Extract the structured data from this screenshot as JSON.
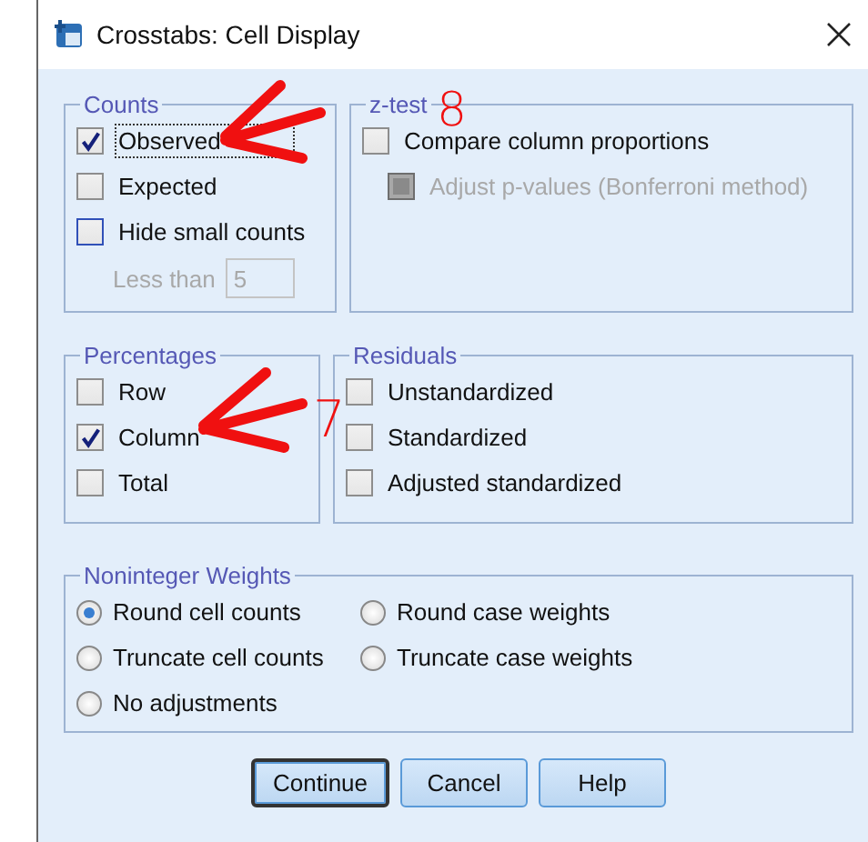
{
  "window": {
    "title": "Crosstabs: Cell Display"
  },
  "counts": {
    "title": "Counts",
    "options": [
      {
        "label": "Observed",
        "checked": true,
        "focused": true
      },
      {
        "label": "Expected",
        "checked": false,
        "focused": false
      },
      {
        "label": "Hide small counts",
        "checked": false,
        "focused": false
      }
    ],
    "less_than": {
      "label": "Less than",
      "value": "5",
      "disabled": true
    }
  },
  "z_test": {
    "title": "z-test",
    "options": [
      {
        "label": "Compare column proportions",
        "checked": false,
        "disabled": false,
        "children": [
          {
            "label": "Adjust p-values (Bonferroni method)",
            "checked": false,
            "disabled": true
          }
        ]
      }
    ]
  },
  "percentages": {
    "title": "Percentages",
    "options": [
      {
        "label": "Row",
        "checked": false
      },
      {
        "label": "Column",
        "checked": true
      },
      {
        "label": "Total",
        "checked": false
      }
    ]
  },
  "residuals": {
    "title": "Residuals",
    "options": [
      {
        "label": "Unstandardized",
        "checked": false
      },
      {
        "label": "Standardized",
        "checked": false
      },
      {
        "label": "Adjusted standardized",
        "checked": false
      }
    ]
  },
  "noninteger_weights": {
    "title": "Noninteger Weights",
    "options": [
      {
        "label": "Round cell counts",
        "selected": true
      },
      {
        "label": "Round case weights",
        "selected": false
      },
      {
        "label": "Truncate cell counts",
        "selected": false
      },
      {
        "label": "Truncate case weights",
        "selected": false
      },
      {
        "label": "No adjustments",
        "selected": false
      }
    ]
  },
  "buttons": [
    {
      "label": "Continue",
      "default": true
    },
    {
      "label": "Cancel",
      "default": false
    },
    {
      "label": "Help",
      "default": false
    }
  ],
  "annotations": [
    {
      "kind": "arrow"
    },
    {
      "kind": "number",
      "text": "8"
    },
    {
      "kind": "arrow"
    },
    {
      "kind": "number",
      "text": "7"
    }
  ]
}
